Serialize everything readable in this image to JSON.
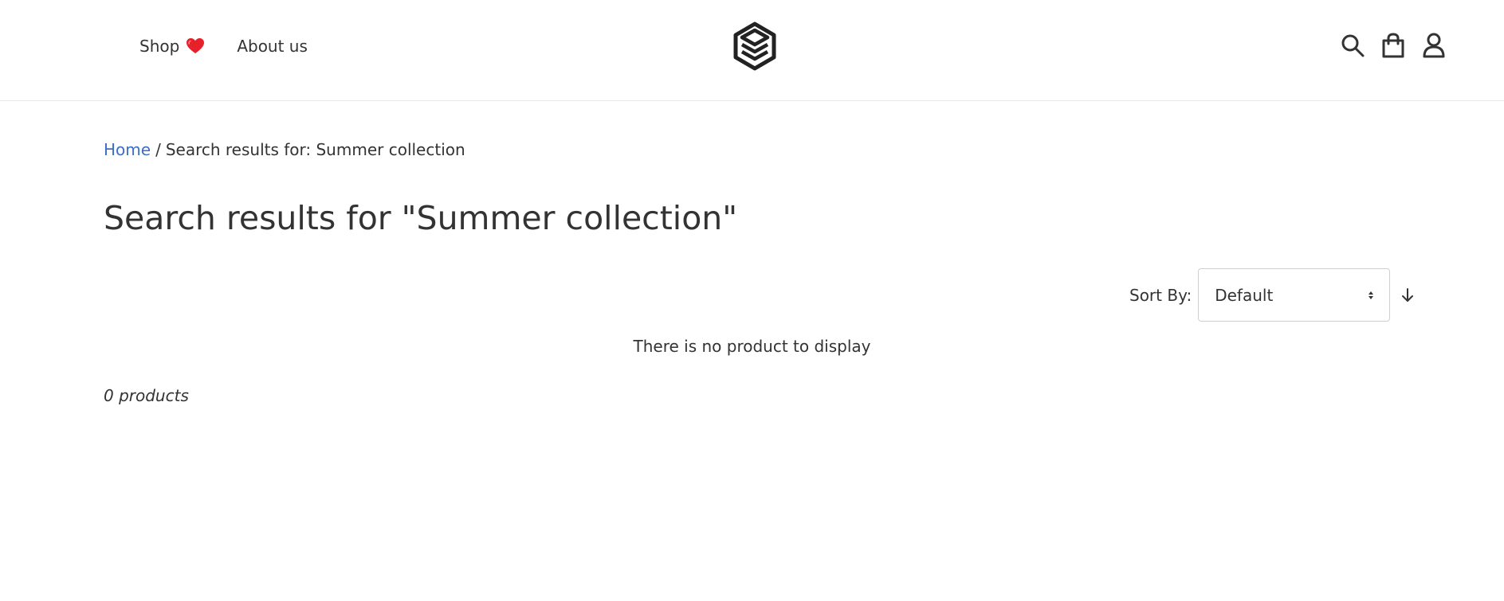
{
  "header": {
    "nav": [
      {
        "label": "Shop",
        "icon": "heart-icon"
      },
      {
        "label": "About us"
      }
    ],
    "logo_icon": "layers-hexagon-logo",
    "icons": [
      "search-icon",
      "shopping-bag-icon",
      "user-icon"
    ],
    "heart_color": "#e8202a"
  },
  "breadcrumb": {
    "home": "Home",
    "separator": "/",
    "current": "Search results for: Summer collection"
  },
  "page_title": "Search results for \"Summer collection\"",
  "sort": {
    "label": "Sort By:",
    "selected": "Default",
    "direction_icon": "arrow-down-icon"
  },
  "empty_message": "There is no product to display",
  "product_count": "0 products",
  "colors": {
    "link": "#3a6fc4",
    "text": "#333333"
  }
}
